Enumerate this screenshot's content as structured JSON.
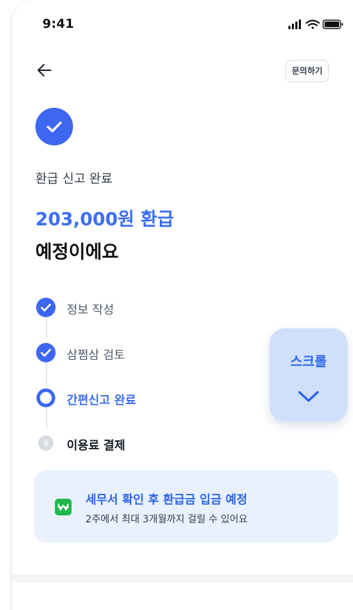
{
  "status_bar": {
    "time": "9:41"
  },
  "nav": {
    "inquiry_label": "문의하기"
  },
  "result": {
    "subtitle": "환급 신고 완료",
    "amount": "203,000원 환급",
    "headline": "예정이에요"
  },
  "steps": [
    {
      "label": "정보 작성",
      "state": "done"
    },
    {
      "label": "삼쩜삼 검토",
      "state": "done"
    },
    {
      "label": "간편신고 완료",
      "state": "current"
    },
    {
      "label": "이용료 결제",
      "state": "pending",
      "number": "4"
    }
  ],
  "scroll_button": {
    "label": "스크롤"
  },
  "notice": {
    "title": "세무서 확인 후 환급금 입금 예정",
    "description": "2주에서 최대 3개월까지 걸릴 수 있어요",
    "icon": "won-badge-icon"
  },
  "colors": {
    "accent": "#3b6ef2",
    "notice_bg": "#e8f1fd",
    "badge_green": "#1fb84f"
  }
}
